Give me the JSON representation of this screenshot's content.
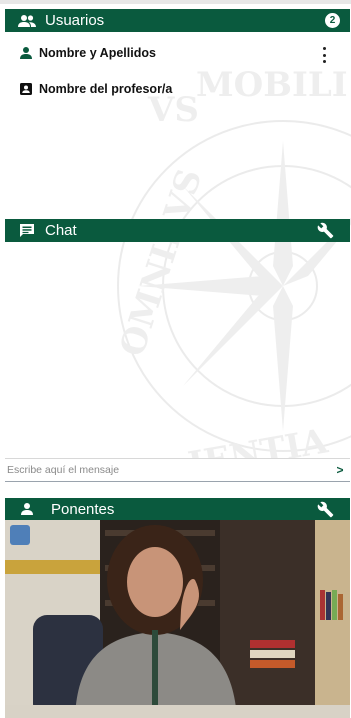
{
  "users_panel": {
    "title": "Usuarios",
    "count": "2",
    "users": [
      {
        "name": "Nombre y Apellidos",
        "icon": "person-icon"
      },
      {
        "name": "Nombre del profesor/a",
        "icon": "contact-card-icon"
      }
    ]
  },
  "chat_panel": {
    "title": "Chat",
    "message_placeholder": "Escribe aquí el mensaje",
    "send_label": ">"
  },
  "speakers_panel": {
    "title": "Ponentes"
  },
  "watermark": {
    "visible_text": [
      "VS",
      "MOBILI",
      "OMNIBVS",
      "IENTIA"
    ]
  },
  "colors": {
    "header_bg": "#0a5a3e",
    "header_text": "#ffffff"
  }
}
